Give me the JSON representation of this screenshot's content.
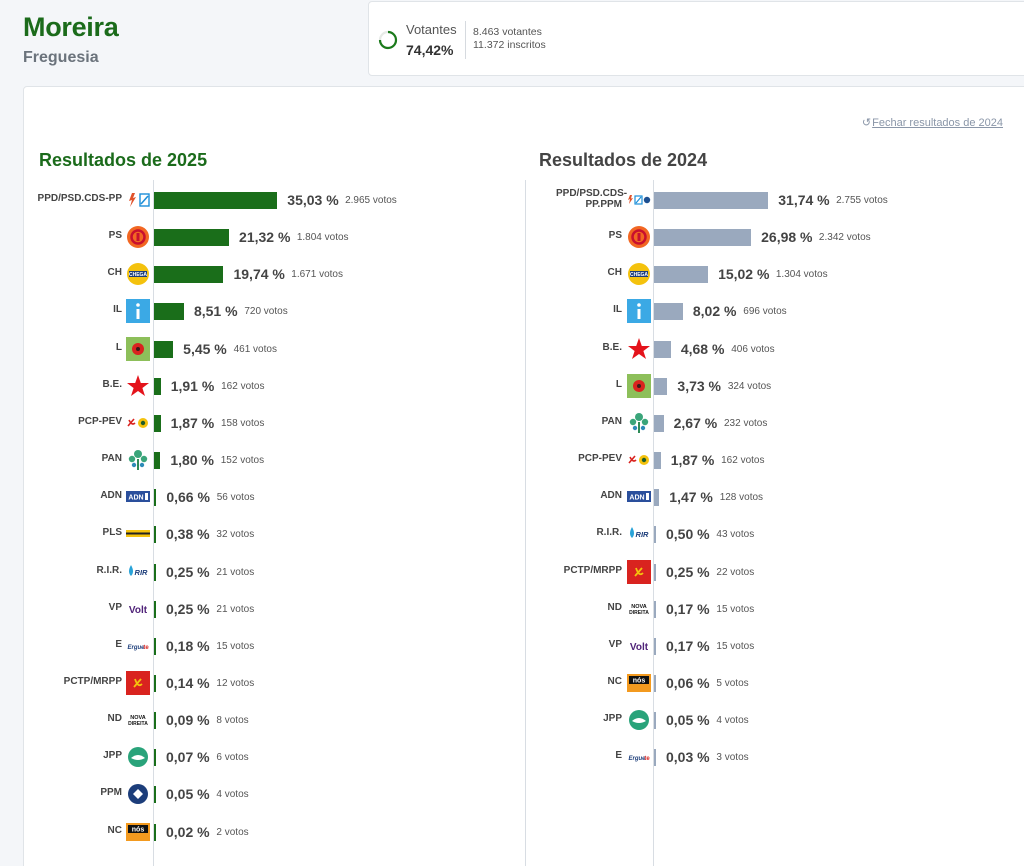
{
  "header": {
    "title": "Moreira",
    "subtitle": "Freguesia"
  },
  "turnout": {
    "label": "Votantes",
    "percent": "74,42%",
    "percent_value": 74.42,
    "voters": "8.463 votantes",
    "registered": "11.372 inscritos"
  },
  "close_link": {
    "icon": "undo-icon",
    "label": "Fechar resultados de 2024"
  },
  "colors": {
    "bar_2025": "#1a6e1a",
    "bar_2024": "#9aa9be",
    "title_2025": "#1b6b1b"
  },
  "chart_data": [
    {
      "type": "bar",
      "orientation": "horizontal",
      "title": "Resultados de 2025",
      "categories": [
        "PPD/PSD.CDS-PP",
        "PS",
        "CH",
        "IL",
        "L",
        "B.E.",
        "PCP-PEV",
        "PAN",
        "ADN",
        "PLS",
        "R.I.R.",
        "VP",
        "E",
        "PCTP/MRPP",
        "ND",
        "JPP",
        "PPM",
        "NC"
      ],
      "values": [
        35.03,
        21.32,
        19.74,
        8.51,
        5.45,
        1.91,
        1.87,
        1.8,
        0.66,
        0.38,
        0.25,
        0.25,
        0.18,
        0.14,
        0.09,
        0.07,
        0.05,
        0.02
      ],
      "percent_labels": [
        "35,03 %",
        "21,32 %",
        "19,74 %",
        "8,51 %",
        "5,45 %",
        "1,91 %",
        "1,87 %",
        "1,80 %",
        "0,66 %",
        "0,38 %",
        "0,25 %",
        "0,25 %",
        "0,18 %",
        "0,14 %",
        "0,09 %",
        "0,07 %",
        "0,05 %",
        "0,02 %"
      ],
      "votes": [
        "2.965 votos",
        "1.804 votos",
        "1.671 votos",
        "720 votos",
        "461 votos",
        "162 votos",
        "158 votos",
        "152 votos",
        "56 votos",
        "32 votos",
        "21 votos",
        "21 votos",
        "15 votos",
        "12 votos",
        "8 votos",
        "6 votos",
        "4 votos",
        "2 votos"
      ],
      "logos": [
        "ad-logo",
        "ps-logo",
        "chega-logo",
        "il-logo",
        "livre-logo",
        "be-logo",
        "cdu-logo",
        "pan-logo",
        "adn-logo",
        "pls-logo",
        "rir-logo",
        "volt-logo",
        "ergue-te-logo",
        "pctp-logo",
        "nova-direita-logo",
        "jpp-logo",
        "ppm-logo",
        "nos-cidadaos-logo"
      ],
      "xlim": [
        0,
        100
      ]
    },
    {
      "type": "bar",
      "orientation": "horizontal",
      "title": "Resultados de 2024",
      "categories": [
        "PPD/PSD.CDS-PP.PPM",
        "PS",
        "CH",
        "IL",
        "B.E.",
        "L",
        "PAN",
        "PCP-PEV",
        "ADN",
        "R.I.R.",
        "PCTP/MRPP",
        "ND",
        "VP",
        "NC",
        "JPP",
        "E"
      ],
      "values": [
        31.74,
        26.98,
        15.02,
        8.02,
        4.68,
        3.73,
        2.67,
        1.87,
        1.47,
        0.5,
        0.25,
        0.17,
        0.17,
        0.06,
        0.05,
        0.03
      ],
      "percent_labels": [
        "31,74 %",
        "26,98 %",
        "15,02 %",
        "8,02 %",
        "4,68 %",
        "3,73 %",
        "2,67 %",
        "1,87 %",
        "1,47 %",
        "0,50 %",
        "0,25 %",
        "0,17 %",
        "0,17 %",
        "0,06 %",
        "0,05 %",
        "0,03 %"
      ],
      "votes": [
        "2.755 votos",
        "2.342 votos",
        "1.304 votos",
        "696 votos",
        "406 votos",
        "324 votos",
        "232 votos",
        "162 votos",
        "128 votos",
        "43 votos",
        "22 votos",
        "15 votos",
        "15 votos",
        "5 votos",
        "4 votos",
        "3 votos"
      ],
      "logos": [
        "ad-ppm-logo",
        "ps-logo",
        "chega-logo",
        "il-logo",
        "be-logo",
        "livre-logo",
        "pan-logo",
        "cdu-logo",
        "adn-logo",
        "rir-logo",
        "pctp-logo",
        "nova-direita-logo",
        "volt-logo",
        "nos-cidadaos-logo",
        "jpp-logo",
        "ergue-te-logo"
      ],
      "xlim": [
        0,
        100
      ]
    }
  ]
}
